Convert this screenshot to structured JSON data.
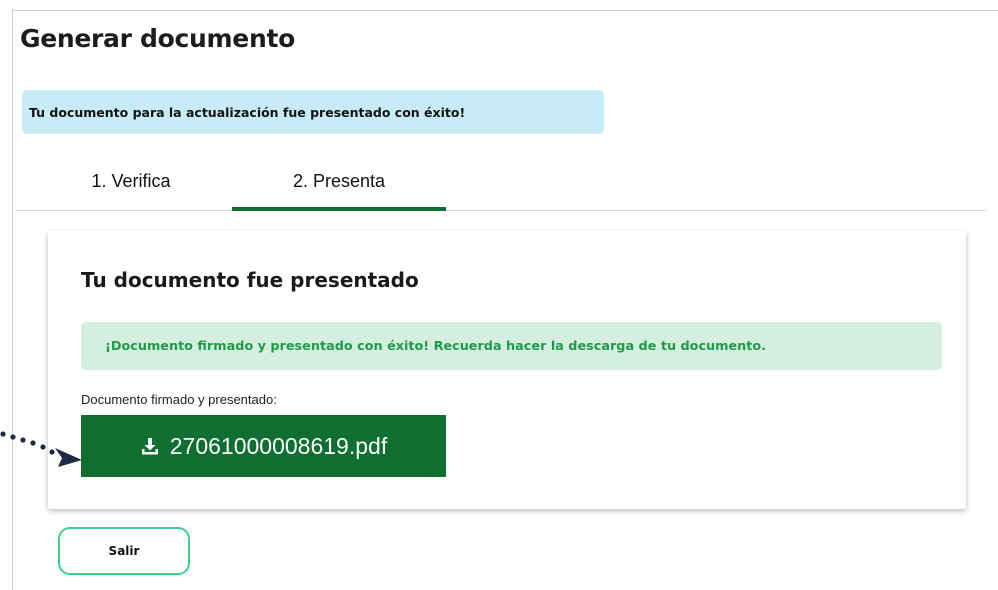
{
  "page": {
    "title": "Generar documento"
  },
  "alerts": {
    "info": "Tu documento para la actualización fue presentado con éxito!",
    "success": "¡Documento firmado y presentado con éxito! Recuerda hacer la descarga de tu documento."
  },
  "tabs": [
    {
      "label": "1. Verifica",
      "active": false
    },
    {
      "label": "2. Presenta",
      "active": true
    }
  ],
  "card": {
    "title": "Tu documento fue presentado",
    "file_label": "Documento firmado y presentado:",
    "file_name": "27061000008619.pdf",
    "download_icon": "download-icon"
  },
  "actions": {
    "exit_label": "Salir"
  },
  "colors": {
    "info_bg": "#c8ecf7",
    "success_bg": "#d4efe0",
    "success_text": "#1f9a47",
    "primary_green": "#0e6f31",
    "outline_green": "#3ecf92",
    "pointer": "#1f2a44"
  }
}
